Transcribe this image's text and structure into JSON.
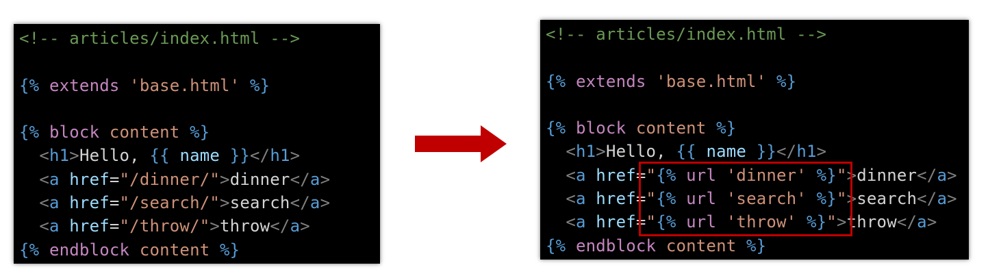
{
  "left_panel": {
    "comment": "<!-- articles/index.html -->",
    "extends": {
      "open": "{%",
      "kw": "extends",
      "str": "'base.html'",
      "close": "%}"
    },
    "block": {
      "open": "{%",
      "kw": "block",
      "name": "content",
      "close": "%}"
    },
    "h1": {
      "indent": "  ",
      "lt": "<",
      "tag": "h1",
      "gt": ">",
      "text": "Hello, ",
      "var_open": "{{",
      "var": " name ",
      "var_close": "}}",
      "end_lt": "</",
      "end_tag": "h1",
      "end_gt": ">"
    },
    "links": [
      {
        "indent": "  ",
        "lt": "<",
        "tag": "a",
        "attr": " href",
        "eq": "=",
        "value": "\"/dinner/\"",
        "gt": ">",
        "text": "dinner",
        "end_lt": "</",
        "end_tag": "a",
        "end_gt": ">"
      },
      {
        "indent": "  ",
        "lt": "<",
        "tag": "a",
        "attr": " href",
        "eq": "=",
        "value": "\"/search/\"",
        "gt": ">",
        "text": "search",
        "end_lt": "</",
        "end_tag": "a",
        "end_gt": ">"
      },
      {
        "indent": "  ",
        "lt": "<",
        "tag": "a",
        "attr": " href",
        "eq": "=",
        "value": "\"/throw/\"",
        "gt": ">",
        "text": "throw",
        "end_lt": "</",
        "end_tag": "a",
        "end_gt": ">"
      }
    ],
    "endblock": {
      "open": "{%",
      "kw": "endblock",
      "name": "content",
      "close": "%}"
    }
  },
  "right_panel": {
    "comment": "<!-- articles/index.html -->",
    "extends": {
      "open": "{%",
      "kw": "extends",
      "str": "'base.html'",
      "close": "%}"
    },
    "block": {
      "open": "{%",
      "kw": "block",
      "name": "content",
      "close": "%}"
    },
    "h1": {
      "indent": "  ",
      "lt": "<",
      "tag": "h1",
      "gt": ">",
      "text": "Hello, ",
      "var_open": "{{",
      "var": " name ",
      "var_close": "}}",
      "end_lt": "</",
      "end_tag": "h1",
      "end_gt": ">"
    },
    "links": [
      {
        "indent": "  ",
        "lt": "<",
        "tag": "a",
        "attr": " href",
        "eq": "=",
        "q1": "\"",
        "t_open": "{%",
        "t_kw": "url",
        "t_str": "'dinner'",
        "t_close": "%}",
        "q2": "\"",
        "gt": ">",
        "text": "dinner",
        "end_lt": "</",
        "end_tag": "a",
        "end_gt": ">"
      },
      {
        "indent": "  ",
        "lt": "<",
        "tag": "a",
        "attr": " href",
        "eq": "=",
        "q1": "\"",
        "t_open": "{%",
        "t_kw": "url",
        "t_str": "'search'",
        "t_close": "%}",
        "q2": "\"",
        "gt": ">",
        "text": "search",
        "end_lt": "</",
        "end_tag": "a",
        "end_gt": ">"
      },
      {
        "indent": "  ",
        "lt": "<",
        "tag": "a",
        "attr": " href",
        "eq": "=",
        "q1": "\"",
        "t_open": "{%",
        "t_kw": "url",
        "t_str": "'throw'",
        "t_close": "%}",
        "q2": "\"",
        "gt": ">",
        "text": "throw",
        "end_lt": "</",
        "end_tag": "a",
        "end_gt": ">"
      }
    ],
    "endblock": {
      "open": "{%",
      "kw": "endblock",
      "name": "content",
      "close": "%}"
    }
  },
  "colors": {
    "comment": "#6a9955",
    "template_delimiter": "#569cd6",
    "template_keyword": "#c586c0",
    "string": "#ce9178",
    "html_tag": "#569cd6",
    "html_attr": "#9cdcfe",
    "text": "#d4d4d4",
    "arrow": "#c00000",
    "highlight": "#c00000"
  },
  "icons": {
    "arrow": "arrow-right-icon"
  }
}
